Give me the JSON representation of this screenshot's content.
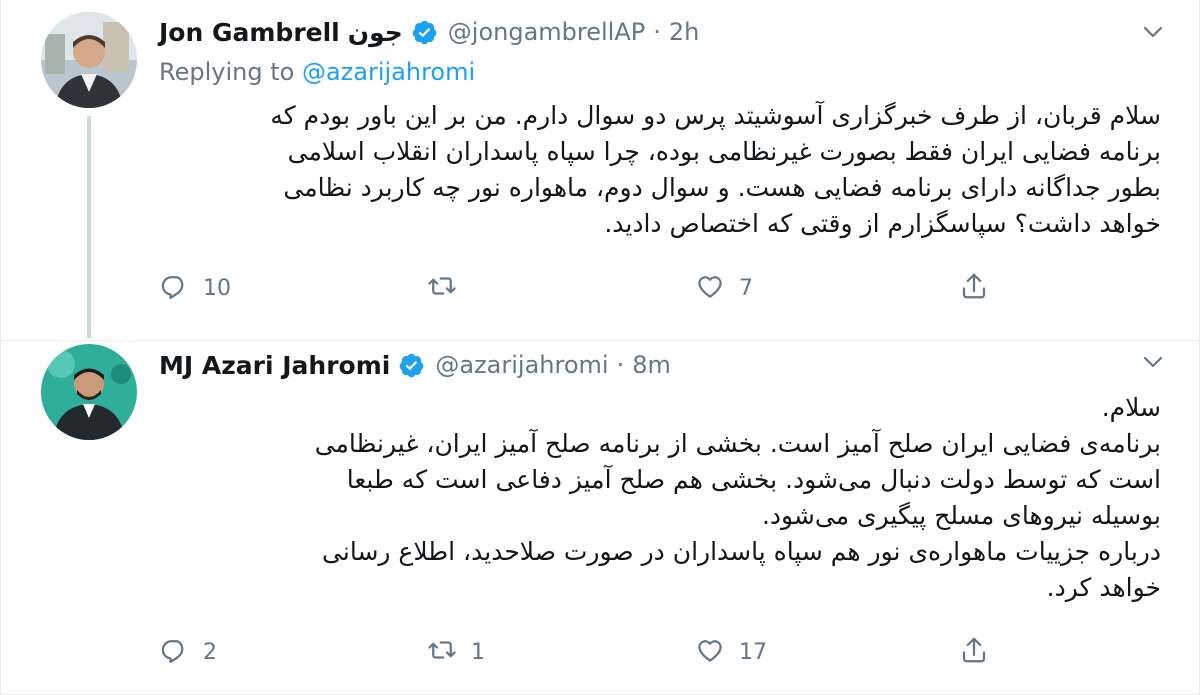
{
  "tweets": [
    {
      "name": "Jon Gambrell",
      "name_fa": "جون",
      "handle": "@jongambrellAP",
      "separator": "·",
      "time": "2h",
      "replying_prefix": "Replying to",
      "replying_mention": "@azarijahromi",
      "body": [
        "سلام قربان، از طرف خبرگزاری آسوشیتد پرس دو سوال دارم. من بر این باور بودم که",
        "برنامه فضایی ایران فقط بصورت غیرنظامی بوده، چرا سپاه پاسداران انقلاب اسلامی",
        "بطور جداگانه دارای برنامه فضایی هست. و سوال دوم، ماهواره نور چه کاربرد نظامی",
        "خواهد داشت؟ سپاسگزارم از وقتی که اختصاص دادید."
      ],
      "reply_count": "10",
      "retweet_count": "",
      "like_count": "7"
    },
    {
      "name": "MJ Azari Jahromi",
      "handle": "@azarijahromi",
      "separator": "·",
      "time": "8m",
      "body": [
        "سلام.",
        "برنامه‌ی فضایی ایران صلح آمیز است. بخشی از برنامه صلح آمیز ایران، غیرنظامی",
        "است که توسط دولت دنبال می‌شود. بخشی هم صلح آمیز دفاعی است که طبعا",
        "بوسیله نیروهای مسلح پیگیری می‌شود.",
        "درباره جزییات ماهواره‌ی نور هم سپاه پاسداران در صورت صلاحدید، اطلاع رسانی",
        "خواهد کرد."
      ],
      "reply_count": "2",
      "retweet_count": "1",
      "like_count": "17"
    }
  ],
  "icons": {
    "verified": "verified-badge-icon",
    "caret": "chevron-down-icon",
    "reply": "reply-bubble-icon",
    "retweet": "retweet-icon",
    "like": "heart-icon",
    "share": "share-icon"
  },
  "colors": {
    "primary_text": "#14171a",
    "secondary_text": "#657786",
    "accent": "#1da1f2",
    "divider": "#e6ecf0",
    "thread_line": "#cfd9de"
  }
}
